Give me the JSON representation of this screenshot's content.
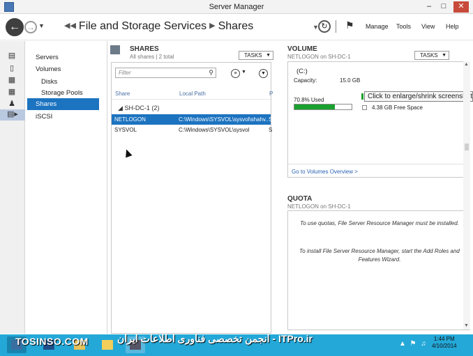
{
  "window": {
    "title": "Server Manager"
  },
  "nav": {
    "breadcrumb": [
      "File and Storage Services",
      "Shares"
    ],
    "menu": [
      "Manage",
      "Tools",
      "View",
      "Help"
    ]
  },
  "sidebar": {
    "items": [
      {
        "label": "Servers"
      },
      {
        "label": "Volumes"
      },
      {
        "label": "Disks"
      },
      {
        "label": "Storage Pools"
      },
      {
        "label": "Shares"
      },
      {
        "label": "iSCSI"
      }
    ]
  },
  "shares": {
    "title": "SHARES",
    "subtitle": "All shares | 2 total",
    "tasks_label": "TASKS",
    "filter_placeholder": "Filter",
    "columns": [
      "Share",
      "Local Path",
      "P"
    ],
    "group_label": "SH-DC-1 (2)",
    "rows": [
      {
        "share": "NETLOGON",
        "path": "C:\\Windows\\SYSVOL\\sysvol\\shahv...",
        "extra": "S"
      },
      {
        "share": "SYSVOL",
        "path": "C:\\Windows\\SYSVOL\\sysvol",
        "extra": "S"
      }
    ]
  },
  "volume": {
    "title": "VOLUME",
    "subtitle": "NETLOGON on SH-DC-1",
    "tasks_label": "TASKS",
    "drive": "(C:)",
    "capacity_label": "Capacity:",
    "capacity_value": "15.0 GB",
    "used_label": "70.8% Used",
    "used_percent": 70.8,
    "free_label": "4.38 GB Free Space",
    "link": "Go to Volumes Overview >",
    "tooltip": "Click to enlarge/shrink screenshot"
  },
  "quota": {
    "title": "QUOTA",
    "subtitle": "NETLOGON on SH-DC-1",
    "message1": "To use quotas, File Server Resource Manager must be installed.",
    "message2": "To install File Server Resource Manager, start the Add Roles and Features Wizard."
  },
  "taskbar": {
    "watermark_left": "TOSINSO.COM",
    "watermark_center": "انجمن تخصصی فناوری اطلاعات ایران - ITPro.ir",
    "time": "1:44 PM",
    "date": "4/10/2014"
  },
  "colors": {
    "accent": "#1c73c0",
    "used_bar": "#1aa02e",
    "taskbar": "#24a8d8"
  }
}
